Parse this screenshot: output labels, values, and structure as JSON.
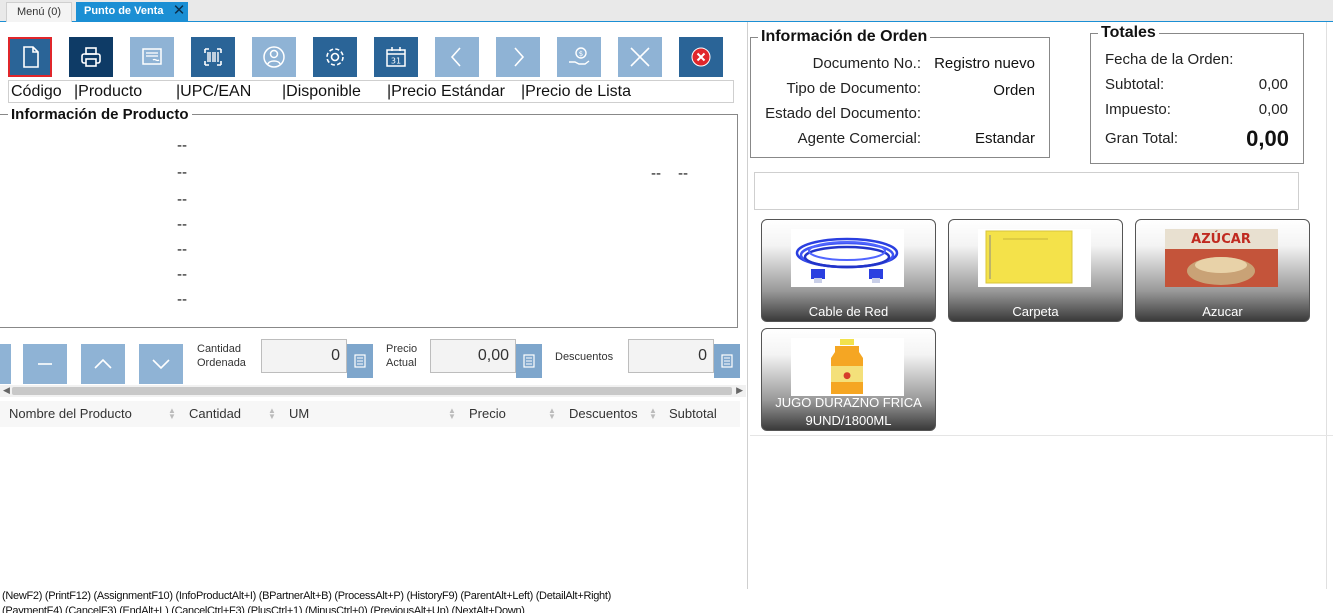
{
  "tabs": {
    "menu_label": "Menú (0)",
    "pos_label": "Punto de Venta"
  },
  "toolbar": {
    "buttons": [
      "new",
      "print",
      "document",
      "barcode",
      "business-partner",
      "process",
      "history",
      "previous",
      "next",
      "payment",
      "cancel",
      "exit"
    ],
    "calendar_day": "31"
  },
  "columns_header": {
    "codigo": "Código",
    "producto": "|Producto",
    "upc": "|UPC/EAN",
    "disponible": "|Disponible",
    "precio_estandar": "|Precio Estándar",
    "precio_lista": "|Precio de Lista"
  },
  "product_info": {
    "title": "Información de Producto",
    "placeholder": "--"
  },
  "quantity": {
    "cantidad_label_1": "Cantidad",
    "cantidad_label_2": "Ordenada",
    "cantidad_value": "0",
    "precio_label_1": "Precio",
    "precio_label_2": "Actual",
    "precio_value": "0,00",
    "descuentos_label": "Descuentos",
    "descuentos_value": "0"
  },
  "grid": {
    "columns": [
      "Nombre del Producto",
      "Cantidad",
      "UM",
      "Precio",
      "Descuentos",
      "Subtotal"
    ],
    "rows": []
  },
  "order_info": {
    "title": "Información de Orden",
    "doc_no_label": "Documento No.:",
    "doc_no_value": "Registro nuevo",
    "doc_type_label": "Tipo de Documento:",
    "doc_type_value": "Orden",
    "doc_status_label": "Estado del Documento:",
    "doc_status_value": "",
    "agent_label": "Agente Comercial:",
    "agent_value": "Estandar"
  },
  "totals": {
    "title": "Totales",
    "date_label": "Fecha de la Orden:",
    "date_value": "",
    "subtotal_label": "Subtotal:",
    "subtotal_value": "0,00",
    "tax_label": "Impuesto:",
    "tax_value": "0,00",
    "grand_label": "Gran Total:",
    "grand_value": "0,00"
  },
  "products": [
    {
      "name": "Cable de Red",
      "image": "network-cable"
    },
    {
      "name": "Carpeta",
      "image": "folder"
    },
    {
      "name": "Azucar",
      "image": "sugar-bag",
      "image_text": "AZÚCAR"
    },
    {
      "name_line1": "JUGO DURAZNO FRICA",
      "name_line2": "9UND/1800ML",
      "image": "juice-bottle"
    }
  ],
  "hotkeys": {
    "line1": "(NewF2) (PrintF12) (AssignmentF10) (InfoProductAlt+I) (BPartnerAlt+B) (ProcessAlt+P) (HistoryF9) (ParentAlt+Left) (DetailAlt+Right)",
    "line2": "(PaymentF4) (CancelF3) (EndAlt+L) (CancelCtrl+F3) (PlusCtrl+1) (MinusCtrl+0) (PreviousAlt+Up) (NextAlt+Down)"
  },
  "colors": {
    "accent": "#1b8fd4",
    "button": "#2a6497",
    "button_light": "#8fb3d5",
    "cancel_red": "#e0262b"
  }
}
